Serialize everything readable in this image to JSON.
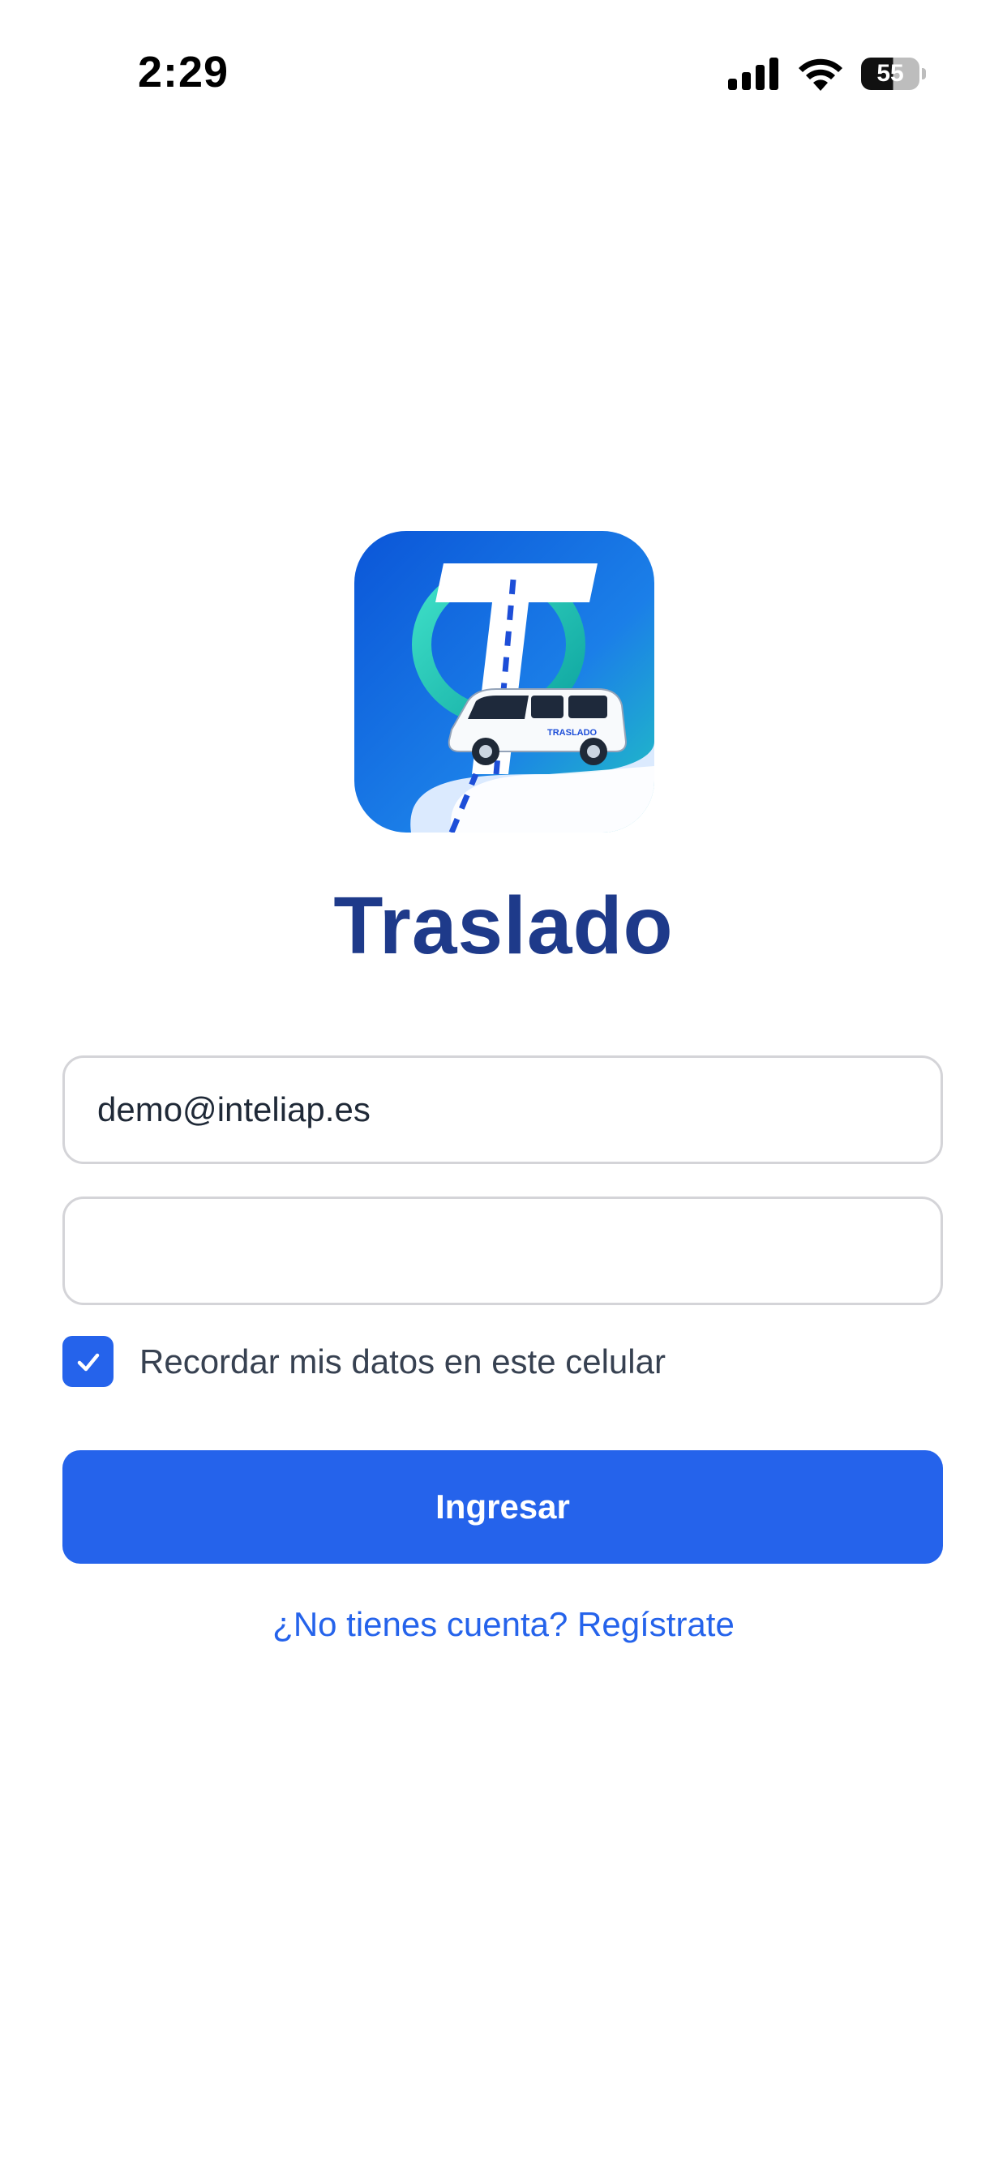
{
  "status_bar": {
    "time": "2:29",
    "battery_level": "55",
    "icons": [
      "signal-icon",
      "wifi-icon",
      "battery-icon"
    ]
  },
  "app": {
    "logo_icon": "traslado-logo-icon",
    "title": "Traslado",
    "logo_van_text": "TRASLADO"
  },
  "form": {
    "email_value": "demo@inteliap.es",
    "password_value": "",
    "remember_checked": true,
    "remember_label": "Recordar mis datos en este celular",
    "login_button_label": "Ingresar",
    "register_link_label": "¿No tienes cuenta? Regístrate"
  },
  "colors": {
    "primary": "#2563eb",
    "title": "#1e3a8a",
    "field_border": "#d4d4d8"
  }
}
